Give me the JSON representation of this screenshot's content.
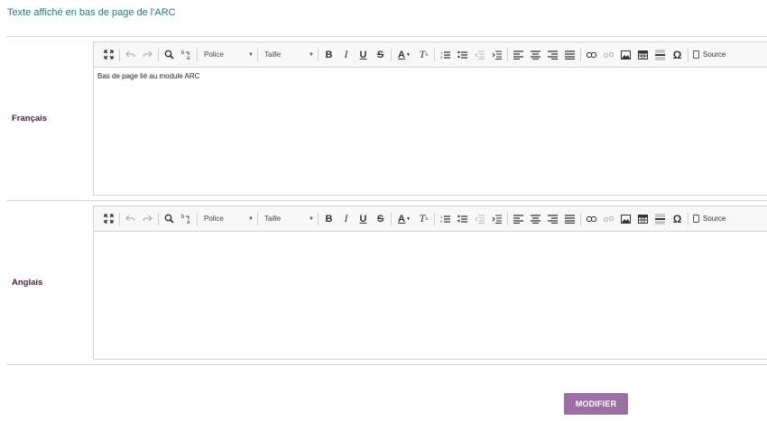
{
  "page": {
    "heading": "Texte affiché en bas de page de l'ARC"
  },
  "editors": [
    {
      "label": "Français",
      "content": "Bas de page lié au module ARC"
    },
    {
      "label": "Anglais",
      "content": ""
    }
  ],
  "toolbar": {
    "font_combo": "Police",
    "size_combo": "Taille",
    "source_label": "Source",
    "icons": [
      "maximize-icon",
      "undo-icon",
      "redo-icon",
      "find-icon",
      "replace-icon",
      "bold-icon",
      "italic-icon",
      "underline-icon",
      "strike-icon",
      "text-color-icon",
      "remove-format-icon",
      "numbered-list-icon",
      "bulleted-list-icon",
      "outdent-icon",
      "indent-icon",
      "align-left-icon",
      "align-center-icon",
      "align-right-icon",
      "justify-icon",
      "link-icon",
      "unlink-icon",
      "image-icon",
      "table-icon",
      "horizontal-rule-icon",
      "special-char-icon",
      "source-icon"
    ]
  },
  "actions": {
    "submit_label": "MODIFIER"
  },
  "colors": {
    "heading": "#23787f",
    "label": "#4a1a3a",
    "button": "#9b6fa3"
  }
}
